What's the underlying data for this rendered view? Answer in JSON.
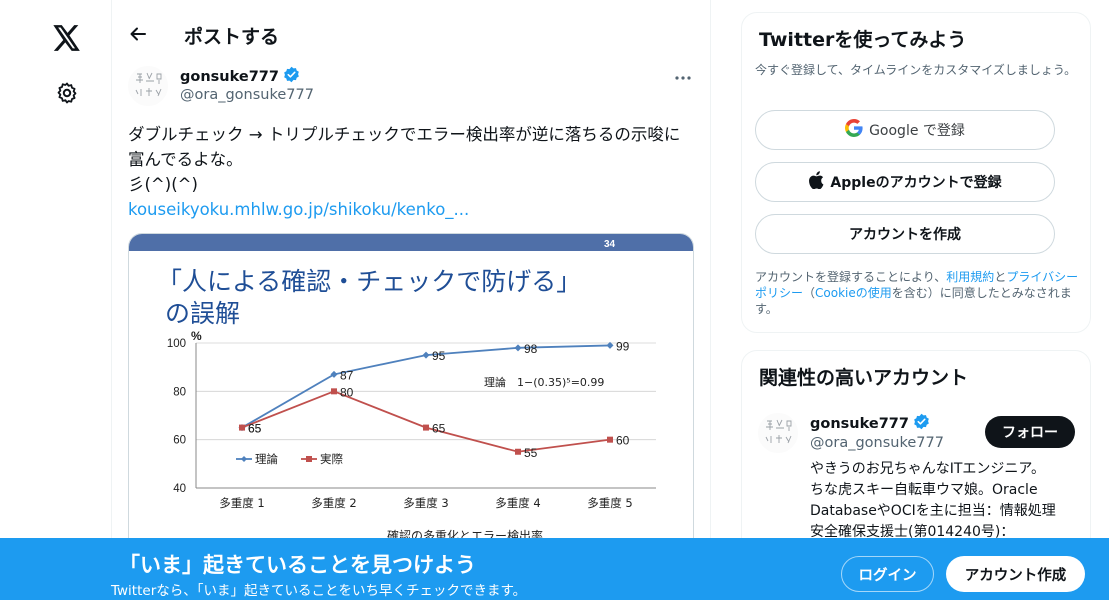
{
  "nav": {
    "logo_icon": "x-logo-icon",
    "settings_icon": "gear-icon"
  },
  "header": {
    "title": "ポストする",
    "back_icon": "arrow-left-icon"
  },
  "tweet": {
    "author_name": "gonsuke777",
    "author_handle": "@ora_gonsuke777",
    "verified_icon": "verified-badge-icon",
    "text_line1": "ダブルチェック → トリプルチェックでエラー検出率が逆に落ちるの示唆に",
    "text_line2": "富んでるよな。",
    "text_line3": "彡(^)(^)",
    "link_text": "kouseikyoku.mhlw.go.jp/shikoku/kenko_..."
  },
  "slide": {
    "page_number": "34",
    "title_line1": "「人による確認・チェックで防げる」",
    "title_line2": "の誤解",
    "theory_formula": "理論　1−(0.35)⁵=0.99",
    "xaxis_caption": "確認の多重化とエラー検出率",
    "ylabel": "%"
  },
  "chart_data": {
    "type": "line",
    "categories": [
      "多重度 1",
      "多重度 2",
      "多重度 3",
      "多重度 4",
      "多重度 5"
    ],
    "series": [
      {
        "name": "理論",
        "values": [
          65,
          87,
          95,
          98,
          99
        ],
        "color": "#4f81bd"
      },
      {
        "name": "実際",
        "values": [
          65,
          80,
          65,
          55,
          60
        ],
        "color": "#c0504d"
      }
    ],
    "ylim": [
      40,
      100
    ],
    "yticks": [
      40,
      60,
      80,
      100
    ],
    "grid": true,
    "legend": "bottom-left"
  },
  "sidebar_signup": {
    "title": "Twitterを使ってみよう",
    "subtitle": "今すぐ登録して、タイムラインをカスタマイズしましょう。",
    "google_label": "Google で登録",
    "apple_label": "Appleのアカウントで登録",
    "create_label": "アカウントを作成",
    "legal_prefix": "アカウントを登録することにより、",
    "terms_link": "利用規約",
    "and_text": "と",
    "privacy_link": "プライバシーポリシー",
    "cookie_open": "（",
    "cookie_link": "Cookieの使用",
    "legal_suffix": "を含む）に同意したとみなされます。"
  },
  "related": {
    "title": "関連性の高いアカウント",
    "name": "gonsuke777",
    "handle": "@ora_gonsuke777",
    "follow_label": "フォロー",
    "bio_line1": "やきうのお兄ちゃんなITエンジニア。",
    "bio_line2": "ちな虎スキー自転車ウマ娘。Oracle",
    "bio_line3": "DatabaseやOCIを主に担当：情報処理",
    "bio_line4": "安全確保支援士(第014240号)："
  },
  "banner": {
    "title": "「いま」起きていることを見つけよう",
    "subtitle": "Twitterなら、「いま」起きていることをいち早くチェックできます。",
    "login_label": "ログイン",
    "signup_label": "アカウント作成"
  },
  "colors": {
    "accent": "#1d9bf0",
    "banner": "#1d9bf0",
    "text": "#0f1419",
    "muted": "#536471"
  }
}
